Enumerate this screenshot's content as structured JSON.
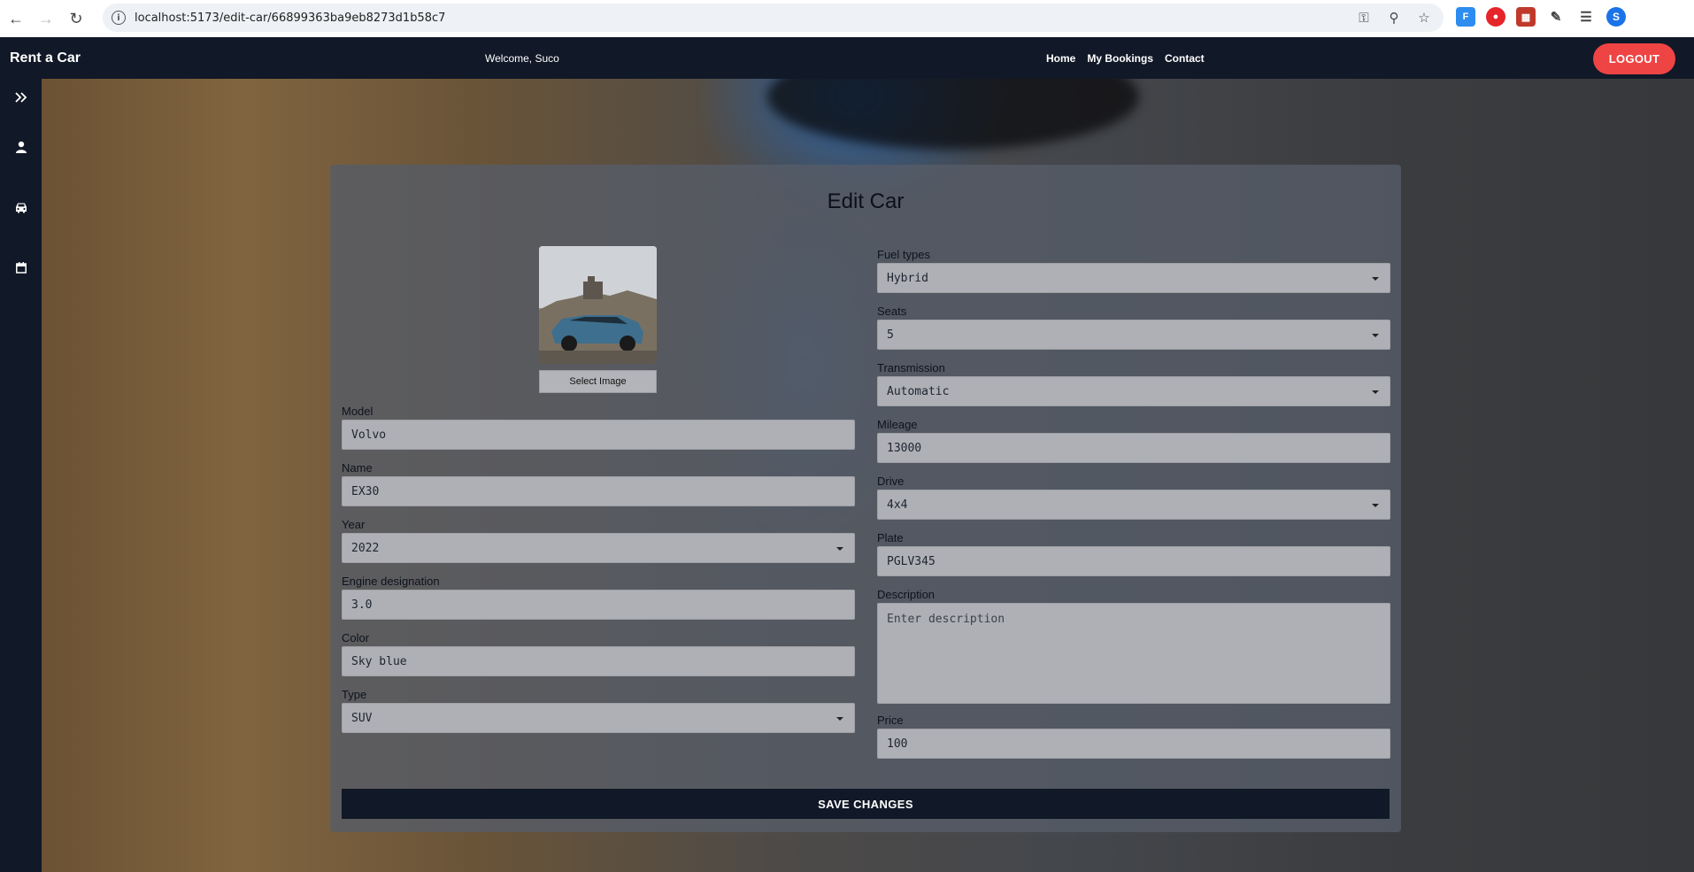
{
  "browser": {
    "url": "localhost:5173/edit-car/66899363ba9eb8273d1b58c7",
    "profile_initial": "S"
  },
  "navbar": {
    "brand": "Rent a Car",
    "welcome": "Welcome, Suco",
    "links": [
      "Home",
      "My Bookings",
      "Contact"
    ],
    "logout": "LOGOUT",
    "logout_color": "#ef4444",
    "background": "#111827"
  },
  "sidebar": {
    "icons": [
      "expand-icon",
      "user-icon",
      "car-icon",
      "calendar-icon"
    ]
  },
  "form": {
    "title": "Edit Car",
    "select_image": "Select Image",
    "left": {
      "model": {
        "label": "Model",
        "value": "Volvo"
      },
      "name": {
        "label": "Name",
        "value": "EX30"
      },
      "year": {
        "label": "Year",
        "value": "2022"
      },
      "engine": {
        "label": "Engine designation",
        "value": "3.0"
      },
      "color": {
        "label": "Color",
        "value": "Sky blue"
      },
      "type": {
        "label": "Type",
        "value": "SUV"
      }
    },
    "right": {
      "fuel": {
        "label": "Fuel types",
        "value": "Hybrid"
      },
      "seats": {
        "label": "Seats",
        "value": "5"
      },
      "transmission": {
        "label": "Transmission",
        "value": "Automatic"
      },
      "mileage": {
        "label": "Mileage",
        "value": "13000"
      },
      "drive": {
        "label": "Drive",
        "value": "4x4"
      },
      "plate": {
        "label": "Plate",
        "value": "PGLV345"
      },
      "description": {
        "label": "Description",
        "placeholder": "Enter description"
      },
      "price": {
        "label": "Price",
        "value": "100"
      }
    },
    "save": "SAVE CHANGES"
  }
}
